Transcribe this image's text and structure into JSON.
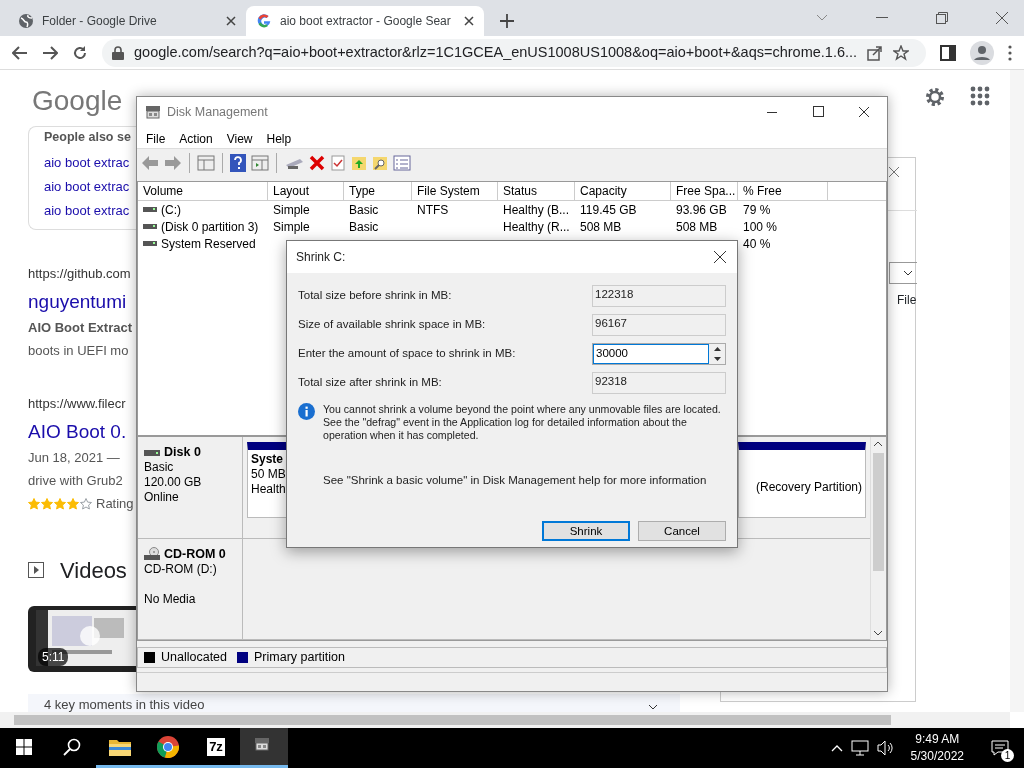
{
  "browser": {
    "tabs": [
      {
        "label": "Folder - Google Drive",
        "kind": "drive",
        "selected": false
      },
      {
        "label": "aio boot extractor - Google Sear",
        "kind": "google",
        "selected": true
      }
    ],
    "address": "google.com/search?q=aio+boot+extractor&rlz=1C1GCEA_enUS1008US1008&oq=aio+boot+&aqs=chrome.1.6..."
  },
  "google": {
    "logo": "Google",
    "people_also_search": {
      "title": "People also se",
      "links": [
        "aio boot extrac",
        "aio boot extrac",
        "aio boot extrac"
      ]
    },
    "results": [
      {
        "url": "https://github.com",
        "title": "nguyentumi",
        "snippet": [
          "**AIO Boot Extract**",
          "boots in UEFI mo"
        ]
      },
      {
        "url": "https://www.filecr",
        "title": "AIO Boot 0.",
        "snippet": [
          "Jun 18, 2021 —",
          "drive with Grub2"
        ],
        "stars": 4,
        "rating": "Rating"
      }
    ],
    "videos": {
      "title": "Videos",
      "duration": "5:11",
      "key_moments": "4 key moments in this video"
    }
  },
  "behind_window": {
    "label": "File"
  },
  "disk_management": {
    "title": "Disk Management",
    "menu": [
      "File",
      "Action",
      "View",
      "Help"
    ],
    "columns": [
      "Volume",
      "Layout",
      "Type",
      "File System",
      "Status",
      "Capacity",
      "Free Spa...",
      "% Free"
    ],
    "rows": [
      [
        "(C:)",
        "Simple",
        "Basic",
        "NTFS",
        "Healthy (B...",
        "119.45 GB",
        "93.96 GB",
        "79 %"
      ],
      [
        "(Disk 0 partition 3)",
        "Simple",
        "Basic",
        null,
        "Healthy (R...",
        "508 MB",
        "508 MB",
        "100 %"
      ],
      [
        "System Reserved",
        null,
        null,
        null,
        null,
        null,
        null,
        "40 %"
      ]
    ],
    "disks": [
      {
        "kind": "disk",
        "name": "Disk 0",
        "lines": [
          "Basic",
          "120.00 GB",
          "Online"
        ],
        "partitions": [
          {
            "name": "Syste",
            "lines": [
              "50 MB",
              "Health"
            ]
          },
          {
            "lines": [
              "(Recovery Partition)"
            ]
          }
        ]
      },
      {
        "kind": "cdrom",
        "name": "CD-ROM 0",
        "lines": [
          "CD-ROM (D:)",
          "No Media"
        ]
      }
    ],
    "legend": [
      {
        "label": "Unallocated",
        "color": "#000000"
      },
      {
        "label": "Primary partition",
        "color": "#000080"
      }
    ]
  },
  "dialog": {
    "title": "Shrink C:",
    "fields": [
      {
        "label": "Total size before shrink in MB:",
        "value": "122318",
        "kind": "readonly"
      },
      {
        "label": "Size of available shrink space in MB:",
        "value": "96167",
        "kind": "readonly"
      },
      {
        "label": "Enter the amount of space to shrink in MB:",
        "value": "30000",
        "kind": "spin"
      },
      {
        "label": "Total size after shrink in MB:",
        "value": "92318",
        "kind": "readonly"
      }
    ],
    "info": "You cannot shrink a volume beyond the point where any unmovable files are located. See the \"defrag\" event in the Application log for detailed information about the operation when it has completed.",
    "help": "See \"Shrink a basic volume\" in Disk Management help for more information",
    "buttons": [
      {
        "label": "Shrink",
        "default": true
      },
      {
        "label": "Cancel",
        "default": false
      }
    ]
  },
  "taskbar": {
    "apps": [
      {
        "kind": "explorer",
        "running": true,
        "selected": false
      },
      {
        "kind": "chrome",
        "running": true,
        "selected": false
      },
      {
        "kind": "sevenzip",
        "label": "7z",
        "running": true,
        "selected": false
      },
      {
        "kind": "diskmgmt",
        "running": true,
        "selected": true
      }
    ],
    "time": "9:49 AM",
    "date": "5/30/2022",
    "notifications": "1"
  }
}
